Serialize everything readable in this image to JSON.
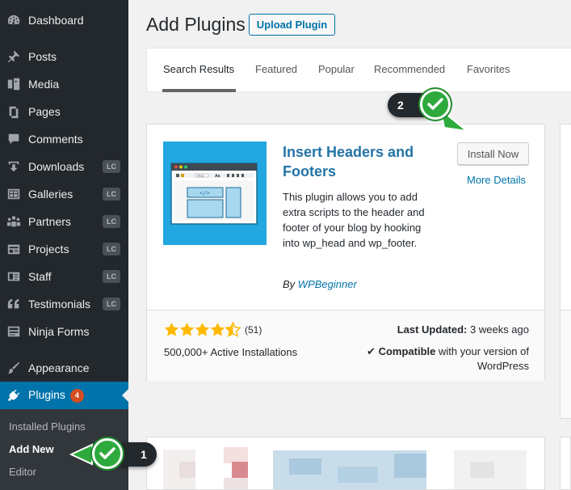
{
  "sidebar": {
    "items": [
      {
        "label": "Dashboard",
        "icon": "dashboard-icon",
        "badge": ""
      },
      {
        "label": "Posts",
        "icon": "pushpin-icon",
        "badge": ""
      },
      {
        "label": "Media",
        "icon": "media-icon",
        "badge": ""
      },
      {
        "label": "Pages",
        "icon": "pages-icon",
        "badge": ""
      },
      {
        "label": "Comments",
        "icon": "comment-icon",
        "badge": ""
      },
      {
        "label": "Downloads",
        "icon": "download-icon",
        "badge": "LC"
      },
      {
        "label": "Galleries",
        "icon": "gallery-icon",
        "badge": "LC"
      },
      {
        "label": "Partners",
        "icon": "groups-icon",
        "badge": "LC"
      },
      {
        "label": "Projects",
        "icon": "portfolio-icon",
        "badge": "LC"
      },
      {
        "label": "Staff",
        "icon": "id-card-icon",
        "badge": "LC"
      },
      {
        "label": "Testimonials",
        "icon": "quote-icon",
        "badge": "LC"
      },
      {
        "label": "Ninja Forms",
        "icon": "form-icon",
        "badge": ""
      },
      {
        "label": "Appearance",
        "icon": "brush-icon",
        "badge": ""
      },
      {
        "label": "Plugins",
        "icon": "plugin-icon",
        "badge": "4"
      }
    ],
    "submenu": [
      "Installed Plugins",
      "Add New",
      "Editor"
    ]
  },
  "header": {
    "title": "Add Plugins",
    "upload_label": "Upload Plugin"
  },
  "tabs": [
    "Search Results",
    "Featured",
    "Popular",
    "Recommended",
    "Favorites"
  ],
  "plugin": {
    "name": "Insert Headers and Footers",
    "description": "This plugin allows you to add extra scripts to the header and footer of your blog by hooking into wp_head and wp_footer.",
    "by": "By",
    "author": "WPBeginner",
    "install_label": "Install Now",
    "details_label": "More Details",
    "rating": 4.5,
    "rating_count": "(51)",
    "installs": "500,000+ Active Installations",
    "last_updated_label": "Last Updated:",
    "last_updated_value": "3 weeks ago",
    "compatible_label": "Compatible",
    "compatible_text": "with your version of WordPress",
    "icon_code_label": "</>",
    "icon_toolbar_label": "Times",
    "icon_font_label": "Aa"
  },
  "callouts": {
    "step1": "1",
    "step2": "2"
  },
  "colors": {
    "sidebar_bg": "#23282d",
    "active_menu": "#0073aa",
    "link": "#0073aa",
    "callout_green": "#2eaa3d",
    "star": "#ffb900",
    "plugin_icon_bg": "#22a7e0"
  }
}
